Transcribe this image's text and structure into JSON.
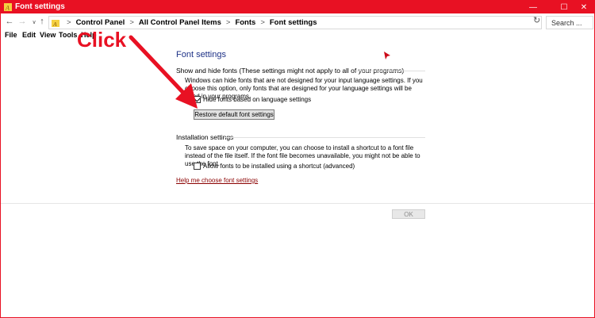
{
  "window": {
    "title": "Font settings",
    "controls": {
      "minimize": "—",
      "maximize": "☐",
      "close": "✕"
    }
  },
  "nav": {
    "back": "←",
    "forward": "→",
    "recent": "∨",
    "up": "↑"
  },
  "address": {
    "crumbs": [
      "Control Panel",
      "All Control Panel Items",
      "Fonts",
      "Font settings"
    ],
    "separator": ">",
    "dropdown": "∨",
    "refresh": "↻"
  },
  "search": {
    "placeholder": "Search ..."
  },
  "menu": {
    "file": "File",
    "edit": "Edit",
    "view": "View",
    "tools": "Tools",
    "help": "Help"
  },
  "main": {
    "page_title": "Font settings",
    "show_hide": {
      "header": "Show and hide fonts (These settings might not apply to all of your programs)",
      "description": "Windows can hide fonts that are not designed for your input language settings. If you choose this option, only fonts that are designed for your language settings will be listed in your programs.",
      "checkbox_label": "Hide fonts based on language settings",
      "checkbox_checked": true,
      "restore_button": "Restore default font settings"
    },
    "installation": {
      "header": "Installation settings",
      "description": "To save space on your computer, you can choose to install a shortcut to a font file instead of the file itself. If the font file becomes unavailable, you might not be able to use the font.",
      "checkbox_label": "Allow fonts to be installed using a shortcut (advanced)",
      "checkbox_checked": false
    },
    "help_link": "Help me choose font settings",
    "ok_button": "OK"
  },
  "annotation": {
    "text": "Click",
    "color": "#e81123"
  },
  "colors": {
    "titlebar": "#e81123",
    "title_text": "#1e3287",
    "link": "#8b0000"
  }
}
